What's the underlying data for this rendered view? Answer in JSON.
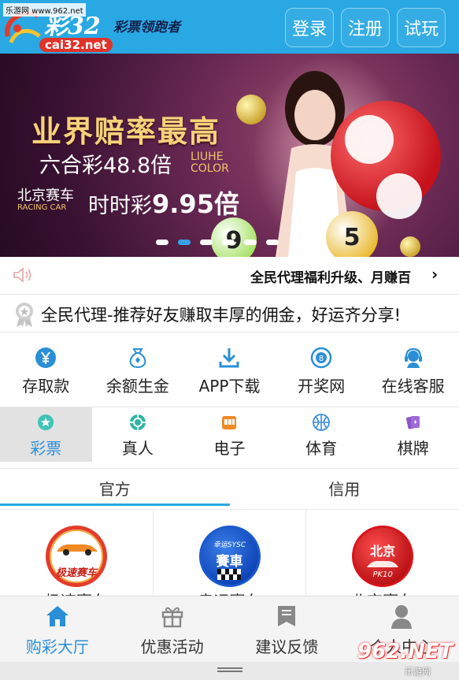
{
  "watermark_top": "乐游网 www.962.net",
  "logo": {
    "main": "彩32",
    "slogan": "彩票领跑者",
    "domain": "cai32.net"
  },
  "header_buttons": {
    "login": "登录",
    "register": "注册",
    "trial": "试玩"
  },
  "banner": {
    "headline": "业界赔率最高",
    "line2_main": "六合彩48.8倍",
    "line2_en": "LIUHE COLOR",
    "line3_left": "北京赛车",
    "line3_left_en": "RACING CAR",
    "line3_main": "时时彩",
    "line3_rate": "9.95倍",
    "ball_numbers": [
      "9",
      "5"
    ],
    "slide_count": 6,
    "active_slide": 2
  },
  "notice": {
    "text": "全民代理福利升级、月赚百",
    "arrow": "›"
  },
  "promo": {
    "text": "全民代理-推荐好友赚取丰厚的佣金，好运齐分享!"
  },
  "quick_actions": [
    {
      "label": "存取款",
      "icon": "yen-icon"
    },
    {
      "label": "余额生金",
      "icon": "money-bag-icon"
    },
    {
      "label": "APP下载",
      "icon": "download-icon"
    },
    {
      "label": "开奖网",
      "icon": "lottery-ball-icon"
    },
    {
      "label": "在线客服",
      "icon": "headset-icon"
    }
  ],
  "categories": [
    {
      "label": "彩票",
      "active": true
    },
    {
      "label": "真人",
      "active": false
    },
    {
      "label": "电子",
      "active": false
    },
    {
      "label": "体育",
      "active": false
    },
    {
      "label": "棋牌",
      "active": false
    }
  ],
  "subtabs": [
    {
      "label": "官方",
      "active": true
    },
    {
      "label": "信用",
      "active": false
    }
  ],
  "games": [
    {
      "name": "极速赛车",
      "badge_text": "极速赛车"
    },
    {
      "name": "幸运赛车",
      "badge_text": "賽車",
      "badge_sub": "幸运SYSC"
    },
    {
      "name": "北京赛车",
      "badge_text": "北京",
      "badge_sub": "PK10"
    }
  ],
  "bottom_nav": [
    {
      "label": "购彩大厅",
      "active": true
    },
    {
      "label": "优惠活动",
      "active": false
    },
    {
      "label": "建议反馈",
      "active": false
    },
    {
      "label": "个人中心",
      "active": false
    }
  ],
  "corner_watermark": {
    "big": "962.NET",
    "small": "乐游网"
  },
  "colors": {
    "header": "#29a8e3",
    "accent": "#2a8fd6",
    "banner_gold": "#f6d27a"
  }
}
